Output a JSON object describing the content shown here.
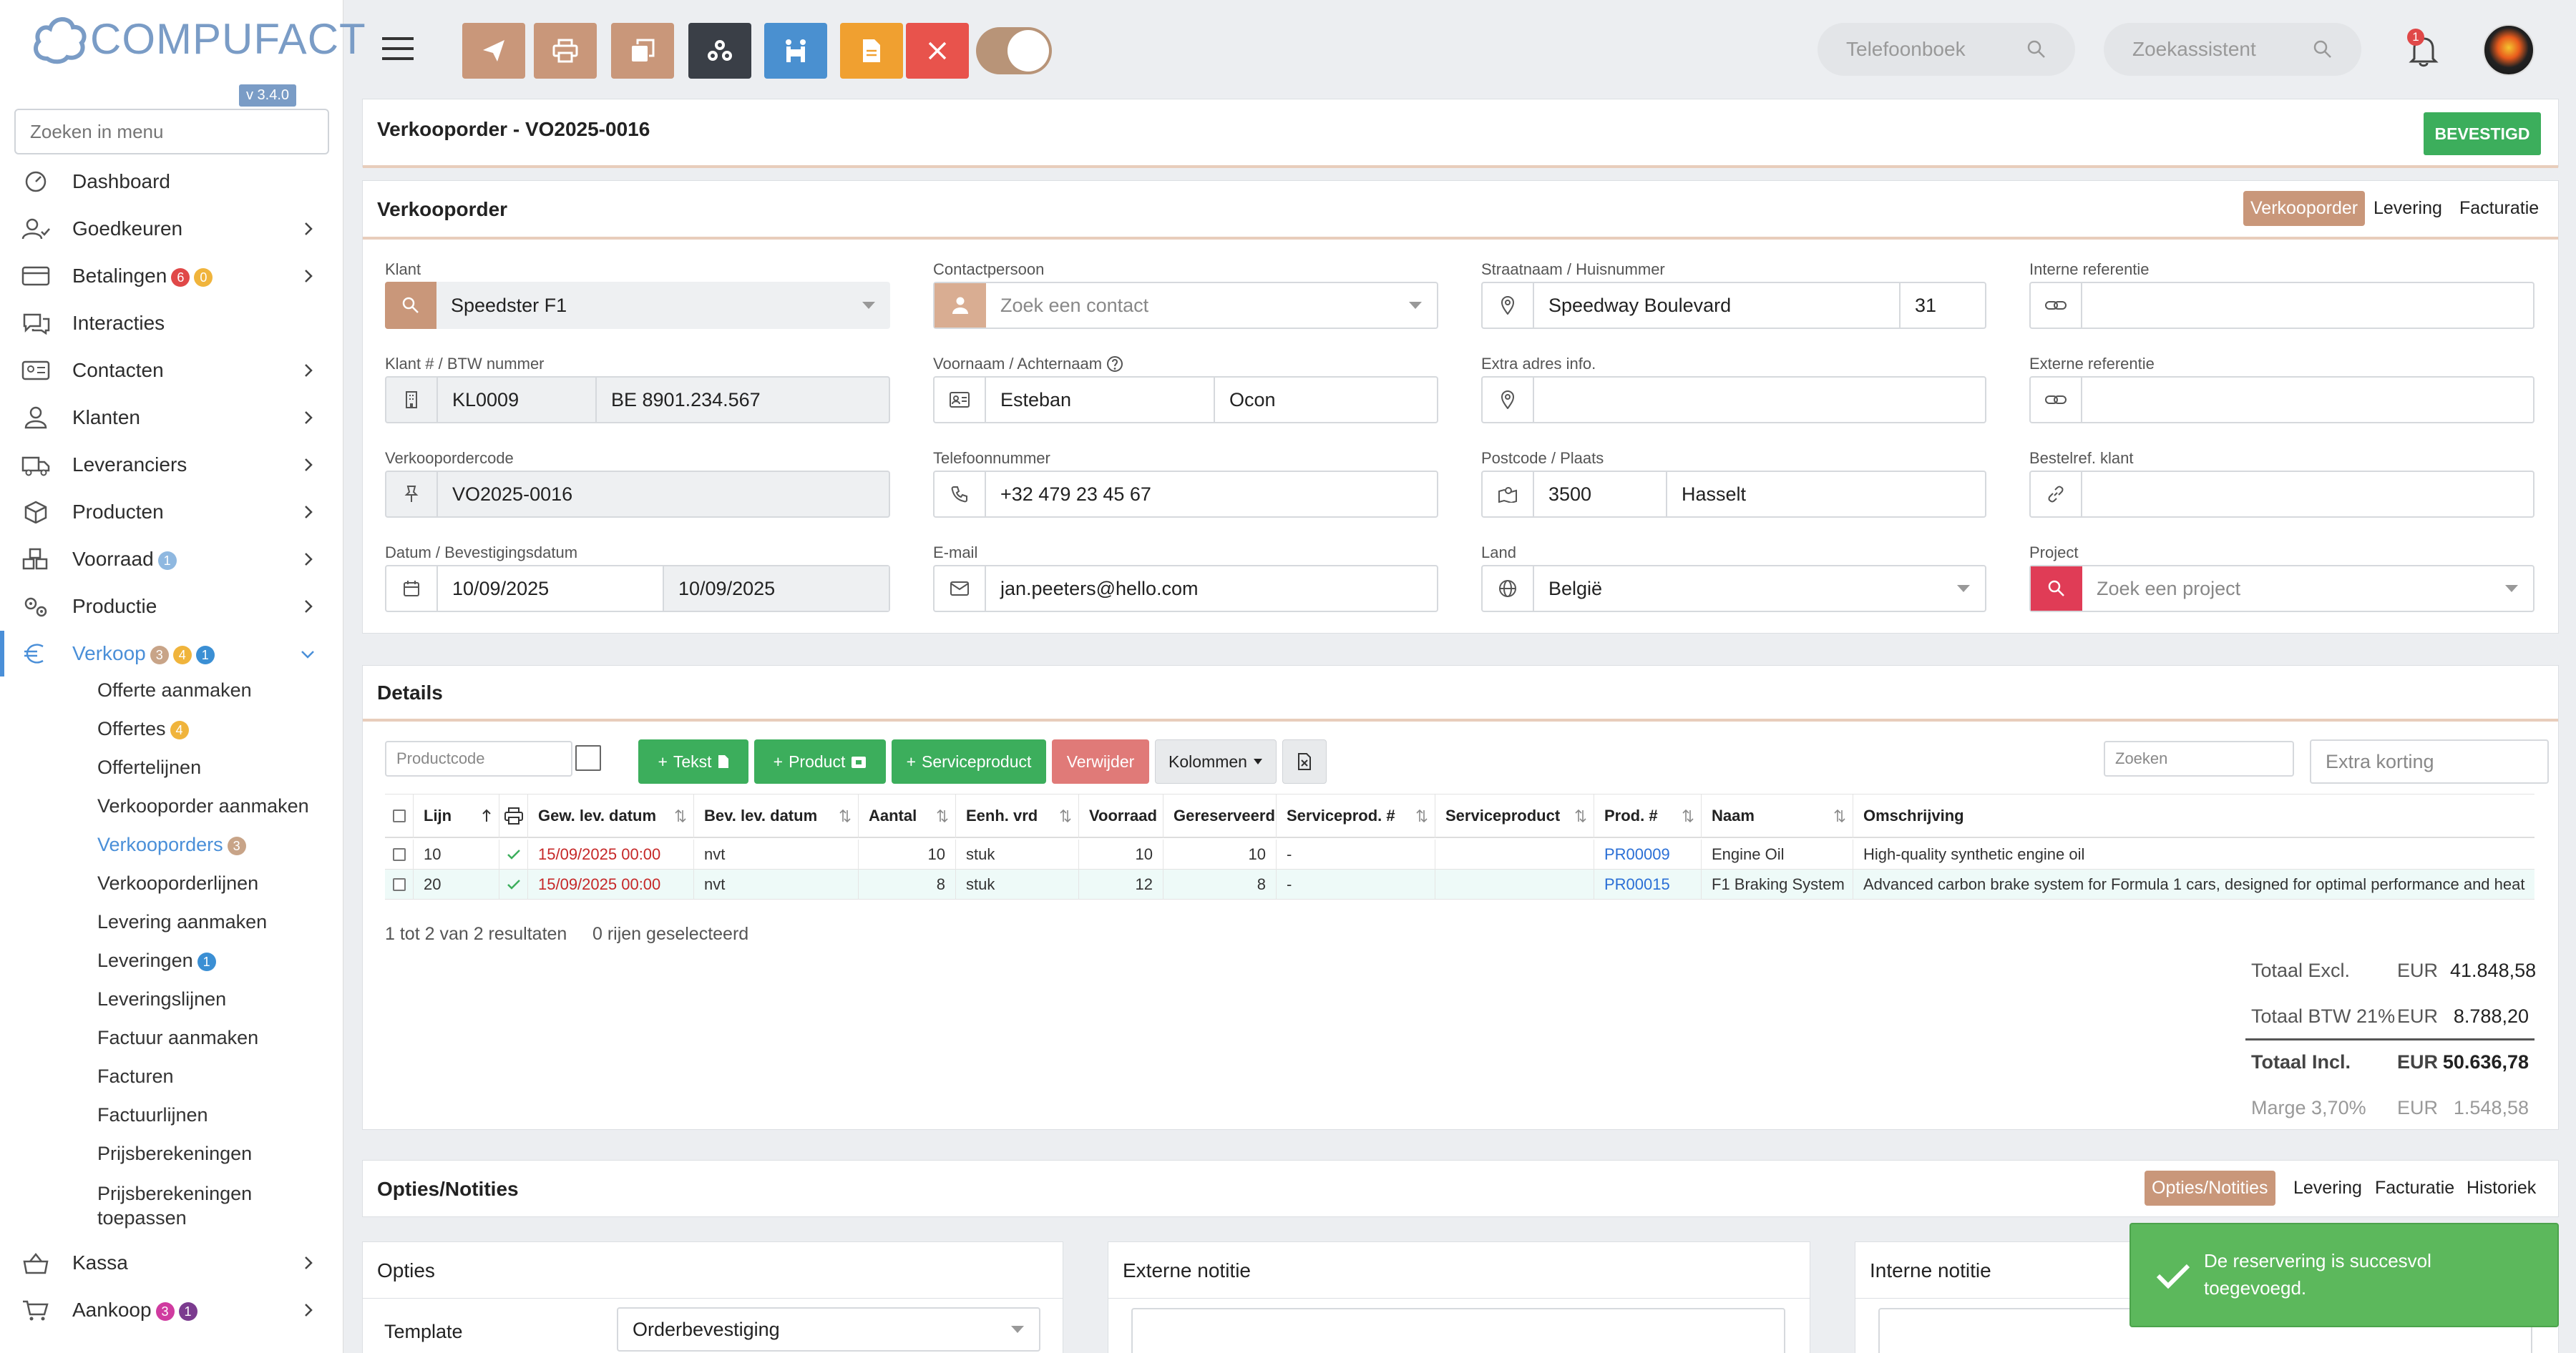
{
  "app": {
    "brand": "COMPUFACT",
    "version": "v 3.4.0"
  },
  "sidebar": {
    "search_placeholder": "Zoeken in menu",
    "items": [
      {
        "label": "Dashboard",
        "icon": "dashboard-icon"
      },
      {
        "label": "Goedkeuren",
        "icon": "user-check-icon"
      },
      {
        "label": "Betalingen",
        "icon": "card-icon",
        "badges": [
          "6",
          "0"
        ]
      },
      {
        "label": "Interacties",
        "icon": "chat-icon"
      },
      {
        "label": "Contacten",
        "icon": "contact-card-icon"
      },
      {
        "label": "Klanten",
        "icon": "person-icon"
      },
      {
        "label": "Leveranciers",
        "icon": "truck-icon"
      },
      {
        "label": "Producten",
        "icon": "box-icon"
      },
      {
        "label": "Voorraad",
        "icon": "boxes-icon",
        "badges": [
          "1"
        ]
      },
      {
        "label": "Productie",
        "icon": "gears-icon"
      },
      {
        "label": "Verkoop",
        "icon": "euro-icon",
        "badges": [
          "3",
          "4",
          "1"
        ]
      },
      {
        "label": "Kassa",
        "icon": "register-icon"
      },
      {
        "label": "Aankoop",
        "icon": "cart-icon",
        "badges": [
          "3",
          "1"
        ]
      }
    ],
    "sub_items": [
      {
        "label": "Offerte aanmaken"
      },
      {
        "label": "Offertes",
        "badge": "4"
      },
      {
        "label": "Offertelijnen"
      },
      {
        "label": "Verkooporder aanmaken"
      },
      {
        "label": "Verkooporders",
        "badge": "3"
      },
      {
        "label": "Verkooporderlijnen"
      },
      {
        "label": "Levering aanmaken"
      },
      {
        "label": "Leveringen",
        "badge": "1"
      },
      {
        "label": "Leveringslijnen"
      },
      {
        "label": "Factuur aanmaken"
      },
      {
        "label": "Facturen"
      },
      {
        "label": "Factuurlijnen"
      },
      {
        "label": "Prijsberekeningen"
      },
      {
        "label": "Prijsberekeningen",
        "label2": "toepassen"
      }
    ]
  },
  "topbar": {
    "phonebook_placeholder": "Telefoonboek",
    "assistant_placeholder": "Zoekassistent",
    "notification_count": "1",
    "colors": {
      "send": "#c9977a",
      "print": "#c9977a",
      "copy": "#c9977a",
      "cluster": "#3a3f47",
      "people": "#4a90d0",
      "doc": "#f0a030",
      "close": "#e8534c"
    }
  },
  "header": {
    "title": "Verkooporder - VO2025-0016",
    "status": "BEVESTIGD",
    "status_color": "#3cae5c"
  },
  "order": {
    "title": "Verkooporder",
    "tabs": [
      "Verkooporder",
      "Levering",
      "Facturatie"
    ],
    "klant_label": "Klant",
    "klant": "Speedster F1",
    "klantnr_label": "Klant # / BTW nummer",
    "klantnr": "KL0009",
    "btw": "BE 8901.234.567",
    "code_label": "Verkoopordercode",
    "code": "VO2025-0016",
    "datum_label": "Datum / Bevestigingsdatum",
    "datum": "10/09/2025",
    "bevestigingsdatum": "10/09/2025",
    "contact_label": "Contactpersoon",
    "contact_placeholder": "Zoek een contact",
    "naam_label": "Voornaam / Achternaam",
    "voornaam": "Esteban",
    "achternaam": "Ocon",
    "tel_label": "Telefoonnummer",
    "tel": "+32 479 23 45 67",
    "email_label": "E-mail",
    "email": "jan.peeters@hello.com",
    "straat_label": "Straatnaam / Huisnummer",
    "straat": "Speedway Boulevard",
    "huisnr": "31",
    "extra_label": "Extra adres info.",
    "postcode_label": "Postcode / Plaats",
    "postcode": "3500",
    "plaats": "Hasselt",
    "land_label": "Land",
    "land": "België",
    "intref_label": "Interne referentie",
    "extref_label": "Externe referentie",
    "bestelref_label": "Bestelref. klant",
    "project_label": "Project",
    "project_placeholder": "Zoek een project"
  },
  "details": {
    "title": "Details",
    "productcode_placeholder": "Productcode",
    "btn_text": "Tekst",
    "btn_product": "Product",
    "btn_service": "Serviceproduct",
    "btn_delete": "Verwijder",
    "btn_columns": "Kolommen",
    "search_placeholder": "Zoeken",
    "discount_placeholder": "Extra korting",
    "columns": [
      "Lijn",
      "Gew. lev. datum",
      "Bev. lev. datum",
      "Aantal",
      "Eenh. vrd",
      "Voorraad",
      "Gereserveerd",
      "Serviceprod. #",
      "Serviceproduct",
      "Prod. #",
      "Naam",
      "Omschrijving"
    ],
    "rows": [
      {
        "lijn": "10",
        "gew": "15/09/2025 00:00",
        "bev": "nvt",
        "aantal": "10",
        "eenh": "stuk",
        "voorraad": "10",
        "geres": "10",
        "servnr": "-",
        "serv": "",
        "prodnr": "PR00009",
        "naam": "Engine Oil",
        "omschr": "High-quality synthetic engine oil"
      },
      {
        "lijn": "20",
        "gew": "15/09/2025 00:00",
        "bev": "nvt",
        "aantal": "8",
        "eenh": "stuk",
        "voorraad": "12",
        "geres": "8",
        "servnr": "-",
        "serv": "",
        "prodnr": "PR00015",
        "naam": "F1 Braking System",
        "omschr": "Advanced carbon brake system for Formula 1 cars, designed for optimal performance and heat"
      }
    ],
    "result_text": "1 tot 2 van 2 resultaten",
    "selected_text": "0 rijen geselecteerd",
    "totals": [
      {
        "label": "Totaal Excl.",
        "cur": "EUR",
        "value": "41.848,58"
      },
      {
        "label": "Totaal BTW 21%",
        "cur": "EUR",
        "value": "8.788,20"
      },
      {
        "label": "Totaal Incl.",
        "cur": "EUR",
        "value": "50.636,78"
      },
      {
        "label": "Marge 3,70%",
        "cur": "EUR",
        "value": "1.548,58"
      }
    ]
  },
  "options": {
    "title": "Opties/Notities",
    "tabs": [
      "Opties/Notities",
      "Levering",
      "Facturatie",
      "Historiek"
    ],
    "opties_title": "Opties",
    "template_label": "Template",
    "template_value": "Orderbevestiging",
    "extern_title": "Externe notitie",
    "intern_title": "Interne notitie"
  },
  "toast": {
    "message": "De reservering is succesvol toegevoegd."
  }
}
